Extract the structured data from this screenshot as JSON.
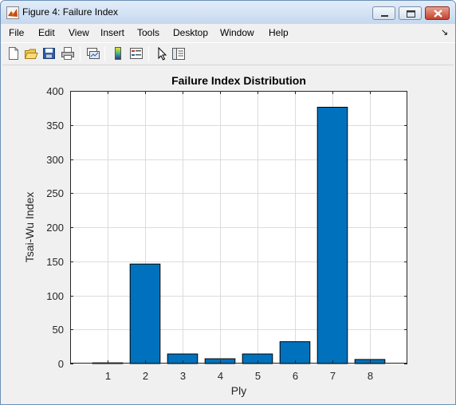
{
  "window": {
    "title": "Figure 4: Failure Index"
  },
  "menu": {
    "items": [
      "File",
      "Edit",
      "View",
      "Insert",
      "Tools",
      "Desktop",
      "Window",
      "Help"
    ]
  },
  "toolbar": {
    "icons": [
      "new-figure-icon",
      "open-file-icon",
      "save-icon",
      "print-icon",
      "link-plot-icon",
      "colorbar-icon",
      "legend-icon",
      "pointer-icon",
      "property-inspector-icon"
    ]
  },
  "colors": {
    "bar_fill": "#0072bd",
    "axes_background": "#ffffff",
    "figure_background": "#f0f0f0"
  },
  "chart_data": {
    "type": "bar",
    "title": "Failure Index Distribution",
    "xlabel": "Ply",
    "ylabel": "Tsai-Wu Index",
    "categories": [
      "1",
      "2",
      "3",
      "4",
      "5",
      "6",
      "7",
      "8"
    ],
    "values": [
      1,
      146,
      14,
      7,
      14,
      32,
      376,
      6
    ],
    "ylim": [
      0,
      400
    ],
    "xlim": [
      0,
      9
    ],
    "yticks": [
      "0",
      "50",
      "100",
      "150",
      "200",
      "250",
      "300",
      "350",
      "400"
    ],
    "grid": true
  }
}
